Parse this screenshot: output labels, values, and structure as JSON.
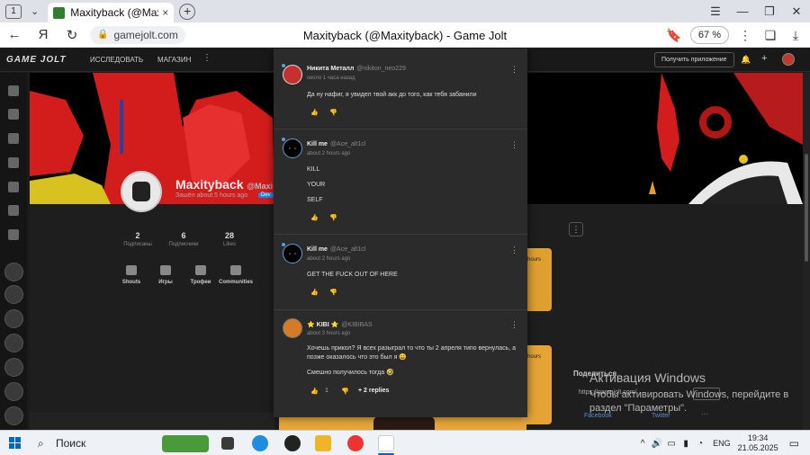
{
  "browser": {
    "tab_count": "1",
    "tab_title": "Maxityback (@Maxityb",
    "tab_close": "×",
    "new_tab": "+",
    "url": "gamejolt.com",
    "page_title": "Maxityback (@Maxityback) - Game Jolt",
    "zoom": "67 %"
  },
  "gamejolt": {
    "logo": "GAME JOLT",
    "nav": [
      "ИССЛЕДОВАТЬ",
      "МАГАЗИН"
    ],
    "app_button": "Получить приложение",
    "profile": {
      "name": "Maxityback",
      "handle": "@Maxi",
      "status": "Зашёл about 5 hours ago",
      "badge": "Dev",
      "stats": [
        {
          "value": "2",
          "label": "Подписаны"
        },
        {
          "value": "6",
          "label": "Подписчики"
        },
        {
          "value": "28",
          "label": "Likes"
        }
      ],
      "tools": [
        "Shouts",
        "Игры",
        "Трофеи",
        "Communities"
      ]
    },
    "card_time_1": "hours",
    "card_time_2": "hours",
    "share": {
      "title": "Поделиться",
      "url": "https://gamejolt.com/",
      "facebook": "Facebook",
      "twitter": "Twitter"
    }
  },
  "comments": [
    {
      "name": "Никита Металл",
      "handle": "@nikiton_neo229",
      "time": "около 1 часа назад",
      "text": [
        "Да ну нафиг, я увидел твой акк до того, как тебя забанили"
      ],
      "avatar": "red"
    },
    {
      "name": "Kill me",
      "handle": "@Ace_alt1cl",
      "time": "about 2 hours ago",
      "text": [
        "KILL",
        "YOUR",
        "SELF"
      ],
      "avatar": "black"
    },
    {
      "name": "Kill me",
      "handle": "@Ace_alt1cl",
      "time": "about 2 hours ago",
      "text": [
        "GET THE FUCK OUT OF HERE"
      ],
      "avatar": "black"
    },
    {
      "name": "⭐ KIBI ⭐",
      "handle": "@KIBIBAS",
      "time": "about 3 hours ago",
      "text": [
        "Хочешь прикол? Я всех разыграл то что ты 2 апреля типо вернулась, а позже оказалось что это был я 😀",
        "Смешно получилось тогда 🤣"
      ],
      "likes": "1",
      "replies": "+ 2 replies",
      "avatar": "orange"
    }
  ],
  "watermark": {
    "line1": "Активация Windows",
    "line2": "Чтобы активировать Windows, перейдите в",
    "line3": "раздел \"Параметры\"."
  },
  "taskbar": {
    "search": "Поиск",
    "lang": "ENG",
    "time": "19:34",
    "date": "21.05.2025"
  },
  "colors": {
    "accent": "#0067c0",
    "modal_bg": "#2b2b2b",
    "gj_green": "#2f7f2f"
  }
}
